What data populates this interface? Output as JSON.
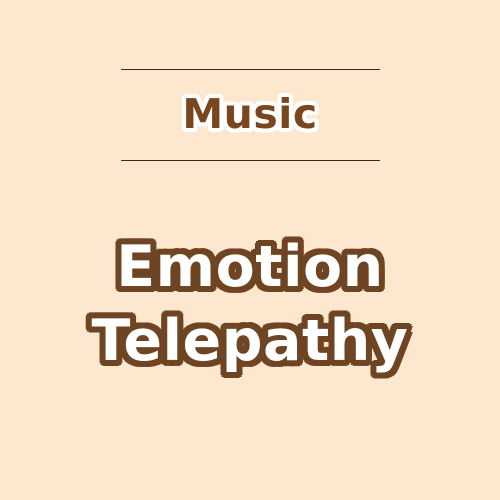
{
  "category": "Music",
  "title": {
    "line1": "Emotion",
    "line2": "Telepathy"
  },
  "colors": {
    "background": "#fde8cf",
    "title_outline": "#6e4422",
    "category_text": "#7a4620",
    "rule": "#3a2a1d"
  }
}
